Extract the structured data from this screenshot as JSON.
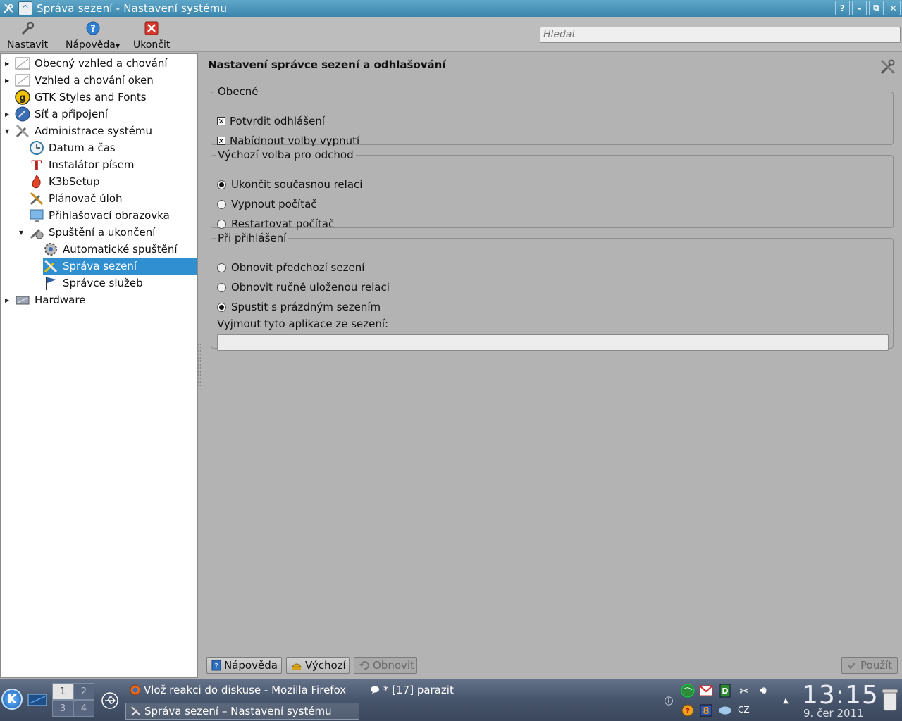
{
  "window": {
    "title": "Správa sezení - Nastavení systému",
    "buttons": [
      "?",
      "–",
      "⧉",
      "✕"
    ]
  },
  "toolbar": {
    "configure_label": "Nastavit",
    "help_label": "Nápověda",
    "quit_label": "Ukončit",
    "search_placeholder": "Hledat"
  },
  "sidebar": {
    "items": [
      {
        "label": "Obecný vzhled a chování",
        "icon": "appearance-icon",
        "level": 0,
        "arrow": "collapsed"
      },
      {
        "label": "Vzhled a chování oken",
        "icon": "window-behavior-icon",
        "level": 0,
        "arrow": "collapsed"
      },
      {
        "label": "GTK Styles and Fonts",
        "icon": "gtk-icon",
        "level": 0,
        "arrow": "none"
      },
      {
        "label": "Síť a připojení",
        "icon": "network-globe-icon",
        "level": 0,
        "arrow": "collapsed"
      },
      {
        "label": "Administrace systému",
        "icon": "tools-icon",
        "level": 0,
        "arrow": "expanded"
      },
      {
        "label": "Datum a čas",
        "icon": "clock-icon",
        "level": 1,
        "arrow": "none"
      },
      {
        "label": "Instalátor písem",
        "icon": "font-installer-icon",
        "level": 1,
        "arrow": "none"
      },
      {
        "label": "K3bSetup",
        "icon": "k3b-icon",
        "level": 1,
        "arrow": "none"
      },
      {
        "label": "Plánovač úloh",
        "icon": "task-scheduler-icon",
        "level": 1,
        "arrow": "none"
      },
      {
        "label": "Přihlašovací obrazovka",
        "icon": "login-screen-icon",
        "level": 1,
        "arrow": "none"
      },
      {
        "label": "Spuštění a ukončení",
        "icon": "startup-shutdown-icon",
        "level": 1,
        "arrow": "expanded"
      },
      {
        "label": "Automatické spuštění",
        "icon": "autostart-gear-icon",
        "level": 2,
        "arrow": "none"
      },
      {
        "label": "Správa sezení",
        "icon": "session-tools-icon",
        "level": 2,
        "arrow": "none",
        "selected": true
      },
      {
        "label": "Správce služeb",
        "icon": "service-flag-icon",
        "level": 2,
        "arrow": "none"
      },
      {
        "label": "Hardware",
        "icon": "hardware-icon",
        "level": 0,
        "arrow": "collapsed"
      }
    ]
  },
  "main": {
    "title": "Nastavení správce sezení a odhlašování",
    "general": {
      "legend": "Obecné",
      "confirm_logout": {
        "label": "Potvrdit odhlášení",
        "checked": true
      },
      "offer_shutdown": {
        "label": "Nabídnout volby vypnutí",
        "checked": true
      }
    },
    "default_leave": {
      "legend": "Výchozí volba pro odchod",
      "options": [
        {
          "label": "Ukončit současnou relaci",
          "selected": true
        },
        {
          "label": "Vypnout počítač",
          "selected": false
        },
        {
          "label": "Restartovat počítač",
          "selected": false
        }
      ]
    },
    "on_login": {
      "legend": "Při přihlášení",
      "options": [
        {
          "label": "Obnovit předchozí sezení",
          "selected": false
        },
        {
          "label": "Obnovit ručně uloženou relaci",
          "selected": false
        },
        {
          "label": "Spustit s prázdným sezením",
          "selected": true
        }
      ],
      "exclude_label": "Vyjmout tyto aplikace ze sezení:",
      "exclude_value": ""
    },
    "buttons": {
      "help": "Nápověda",
      "defaults": "Výchozí",
      "reset": "Obnovit",
      "apply": "Použít"
    }
  },
  "taskbar": {
    "pager": [
      "1",
      "2",
      "3",
      "4"
    ],
    "tasks": [
      {
        "label": "Vlož reakci do diskuse - Mozilla Firefox",
        "active": false
      },
      {
        "label": "Správa sezení – Nastavení systému",
        "active": true
      }
    ],
    "chat_task": "* [17] parazit",
    "language": "CZ",
    "clock": "13:15",
    "date": "9. čer 2011"
  },
  "colors": {
    "titlebar": "#3b86ad",
    "selection": "#2f8fd1",
    "panel_bg": "#b3b3b3",
    "sidebar_bg": "#ffffff"
  }
}
